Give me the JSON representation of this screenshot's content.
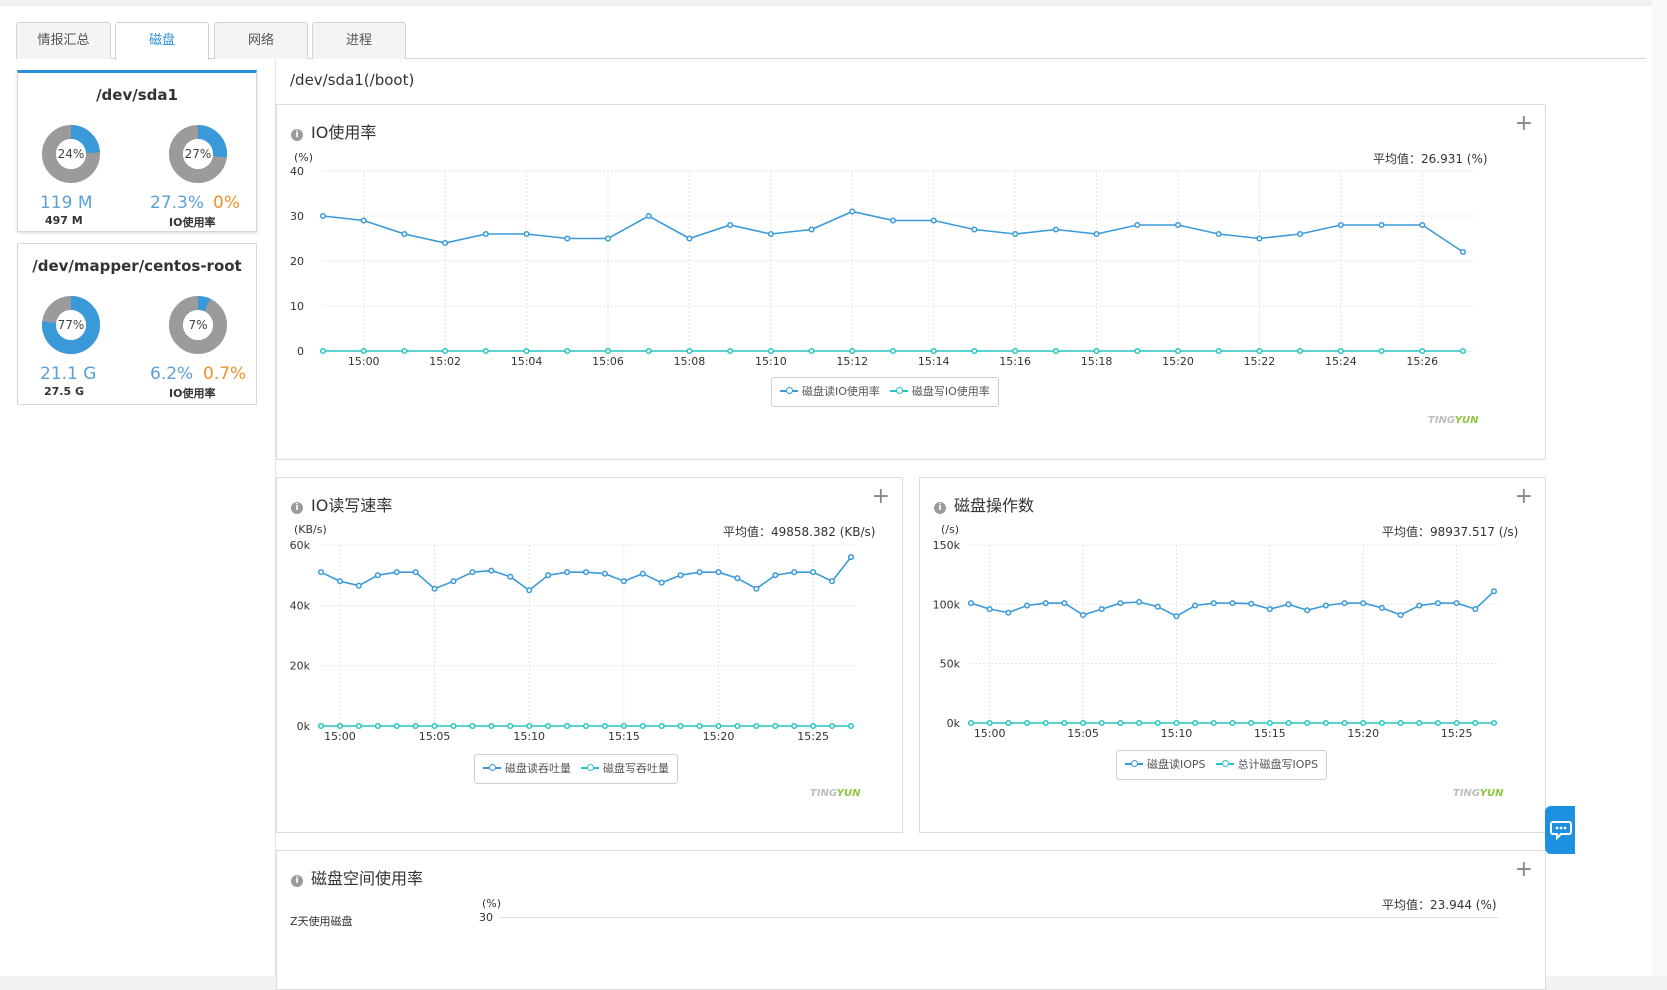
{
  "tabs": [
    {
      "label": "情报汇总",
      "active": false
    },
    {
      "label": "磁盘",
      "active": true
    },
    {
      "label": "网络",
      "active": false
    },
    {
      "label": "进程",
      "active": false
    }
  ],
  "disks": [
    {
      "name": "/dev/sda1",
      "used_pct": 24,
      "used_pct_label": "24%",
      "used": "119 M",
      "total": "497 M",
      "io_pct": 27,
      "io_pct_label": "27%",
      "io_read": "27.3%",
      "io_write": "0%",
      "io_label": "IO使用率",
      "active": true
    },
    {
      "name": "/dev/mapper/centos-root",
      "used_pct": 77,
      "used_pct_label": "77%",
      "used": "21.1 G",
      "total": "27.5 G",
      "io_pct": 7,
      "io_pct_label": "7%",
      "io_read": "6.2%",
      "io_write": "0.7%",
      "io_label": "IO使用率",
      "active": false
    }
  ],
  "page_title": "/dev/sda1(/boot)",
  "panels": {
    "io_usage": {
      "title": "IO使用率",
      "unit": "(%)",
      "avg": "平均值：26.931 (%)",
      "legend": [
        "磁盘读IO使用率",
        "磁盘写IO使用率"
      ]
    },
    "io_rate": {
      "title": "IO读写速率",
      "unit": "(KB/s)",
      "avg": "平均值：49858.382 (KB/s)",
      "legend": [
        "磁盘读吞吐量",
        "磁盘写吞吐量"
      ]
    },
    "iops": {
      "title": "磁盘操作数",
      "unit": "(/s)",
      "avg": "平均值：98937.517 (/s)",
      "legend": [
        "磁盘读IOPS",
        "总计磁盘写IOPS"
      ]
    },
    "space": {
      "title": "磁盘空间使用率",
      "unit": "(%)",
      "avg": "平均值：23.944 (%)",
      "ytick_top": "30",
      "left_label": "Z天使用磁盘"
    }
  },
  "watermark": {
    "ting": "TING",
    "yun": "YUN"
  },
  "colors": {
    "accent": "#2b8fd8",
    "series_read": "#3a9ad9",
    "series_write": "#28c4c4",
    "donut_gray": "#9b9b9b",
    "orange": "#f0902a"
  },
  "chart_data": [
    {
      "type": "line",
      "title": "IO使用率",
      "ylabel": "(%)",
      "ylim": [
        0,
        40
      ],
      "yticks": [
        0,
        10,
        20,
        30,
        40
      ],
      "x": [
        "14:59",
        "15:00",
        "15:01",
        "15:02",
        "15:03",
        "15:04",
        "15:05",
        "15:06",
        "15:07",
        "15:08",
        "15:09",
        "15:10",
        "15:11",
        "15:12",
        "15:13",
        "15:14",
        "15:15",
        "15:16",
        "15:17",
        "15:18",
        "15:19",
        "15:20",
        "15:21",
        "15:22",
        "15:23",
        "15:24",
        "15:25",
        "15:26",
        "15:27"
      ],
      "xticks": [
        "15:00",
        "15:02",
        "15:04",
        "15:06",
        "15:08",
        "15:10",
        "15:12",
        "15:14",
        "15:16",
        "15:18",
        "15:20",
        "15:22",
        "15:24",
        "15:26"
      ],
      "series": [
        {
          "name": "磁盘读IO使用率",
          "values": [
            30,
            29,
            26,
            24,
            26,
            26,
            25,
            25,
            30,
            25,
            28,
            26,
            27,
            31,
            29,
            29,
            27,
            26,
            27,
            26,
            28,
            28,
            26,
            25,
            26,
            28,
            28,
            28,
            22
          ]
        },
        {
          "name": "磁盘写IO使用率",
          "values": [
            0,
            0,
            0,
            0,
            0,
            0,
            0,
            0,
            0,
            0,
            0,
            0,
            0,
            0,
            0,
            0,
            0,
            0,
            0,
            0,
            0,
            0,
            0,
            0,
            0,
            0,
            0,
            0,
            0
          ]
        }
      ],
      "legend": "bottom-center",
      "grid": true
    },
    {
      "type": "line",
      "title": "IO读写速率",
      "ylabel": "(KB/s)",
      "ylim": [
        0,
        60000
      ],
      "yticks": [
        0,
        20000,
        40000,
        60000
      ],
      "ytick_labels": [
        "0k",
        "20k",
        "40k",
        "60k"
      ],
      "x": [
        "14:59",
        "15:00",
        "15:01",
        "15:02",
        "15:03",
        "15:04",
        "15:05",
        "15:06",
        "15:07",
        "15:08",
        "15:09",
        "15:10",
        "15:11",
        "15:12",
        "15:13",
        "15:14",
        "15:15",
        "15:16",
        "15:17",
        "15:18",
        "15:19",
        "15:20",
        "15:21",
        "15:22",
        "15:23",
        "15:24",
        "15:25",
        "15:26",
        "15:27"
      ],
      "xticks": [
        "15:00",
        "15:05",
        "15:10",
        "15:15",
        "15:20",
        "15:25"
      ],
      "series": [
        {
          "name": "磁盘读吞吐量",
          "values": [
            51000,
            48000,
            46500,
            50000,
            51000,
            51000,
            45500,
            48000,
            51000,
            51500,
            49500,
            45000,
            50000,
            51000,
            51000,
            50500,
            48000,
            50500,
            47500,
            50000,
            51000,
            51000,
            49000,
            45500,
            50000,
            51000,
            51000,
            48000,
            56000
          ]
        },
        {
          "name": "磁盘写吞吐量",
          "values": [
            0,
            0,
            0,
            0,
            0,
            0,
            0,
            0,
            0,
            0,
            0,
            0,
            0,
            0,
            0,
            0,
            0,
            0,
            0,
            0,
            0,
            0,
            0,
            0,
            0,
            0,
            0,
            0,
            0
          ]
        }
      ],
      "legend": "bottom-center",
      "grid": true
    },
    {
      "type": "line",
      "title": "磁盘操作数",
      "ylabel": "(/s)",
      "ylim": [
        0,
        150000
      ],
      "yticks": [
        0,
        50000,
        100000,
        150000
      ],
      "ytick_labels": [
        "0k",
        "50k",
        "100k",
        "150k"
      ],
      "x": [
        "14:59",
        "15:00",
        "15:01",
        "15:02",
        "15:03",
        "15:04",
        "15:05",
        "15:06",
        "15:07",
        "15:08",
        "15:09",
        "15:10",
        "15:11",
        "15:12",
        "15:13",
        "15:14",
        "15:15",
        "15:16",
        "15:17",
        "15:18",
        "15:19",
        "15:20",
        "15:21",
        "15:22",
        "15:23",
        "15:24",
        "15:25",
        "15:26",
        "15:27"
      ],
      "xticks": [
        "15:00",
        "15:05",
        "15:10",
        "15:15",
        "15:20",
        "15:25"
      ],
      "series": [
        {
          "name": "磁盘读IOPS",
          "values": [
            101000,
            96000,
            93000,
            99000,
            101000,
            101000,
            91000,
            96000,
            101000,
            102000,
            98000,
            90000,
            99000,
            101000,
            101000,
            100500,
            96000,
            100000,
            95000,
            99000,
            101000,
            101000,
            97000,
            91000,
            99000,
            101000,
            101000,
            96000,
            111000
          ]
        },
        {
          "name": "总计磁盘写IOPS",
          "values": [
            0,
            0,
            0,
            0,
            0,
            0,
            0,
            0,
            0,
            0,
            0,
            0,
            0,
            0,
            0,
            0,
            0,
            0,
            0,
            0,
            0,
            0,
            0,
            0,
            0,
            0,
            0,
            0,
            0
          ]
        }
      ],
      "legend": "bottom-center",
      "grid": true
    }
  ]
}
